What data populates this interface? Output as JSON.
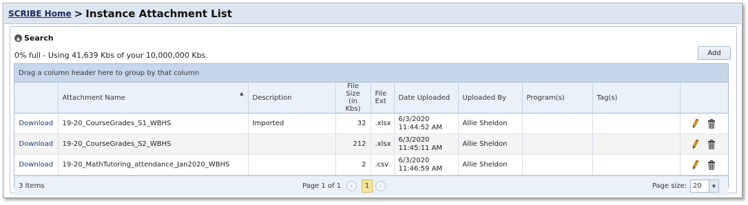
{
  "header": {
    "breadcrumb_home": "SCRIBE Home",
    "separator": ">",
    "title": "Instance Attachment List"
  },
  "search": {
    "label": "Search",
    "icon": "collapse-circle-icon"
  },
  "usage_text": "0% full - Using 41,639 Kbs of your 10,000,000 Kbs.",
  "add_label": "Add",
  "grid": {
    "group_hint": "Drag a column header here to group by that column",
    "columns": {
      "attachment_name": "Attachment Name",
      "description": "Description",
      "file_size_1": "File Size",
      "file_size_2": "(in Kbs)",
      "file_ext_1": "File",
      "file_ext_2": "Ext",
      "date_uploaded": "Date Uploaded",
      "uploaded_by": "Uploaded By",
      "programs": "Program(s)",
      "tags": "Tag(s)"
    },
    "rows": [
      {
        "action": "Download",
        "name": "19-20_CourseGrades_S1_WBHS",
        "description": "Imported",
        "size": "32",
        "ext": ".xlsx",
        "date": "6/3/2020",
        "time": "11:44:52 AM",
        "by": "Allie Sheldon",
        "programs": "",
        "tags": ""
      },
      {
        "action": "Download",
        "name": "19-20_CourseGrades_S2_WBHS",
        "description": "",
        "size": "212",
        "ext": ".xlsx",
        "date": "6/3/2020",
        "time": "11:45:11 AM",
        "by": "Allie Sheldon",
        "programs": "",
        "tags": ""
      },
      {
        "action": "Download",
        "name": "19-20_MathTutoring_attendance_Jan2020_WBHS",
        "description": "",
        "size": "2",
        "ext": ".csv",
        "date": "6/3/2020",
        "time": "11:46:59 AM",
        "by": "Allie Sheldon",
        "programs": "",
        "tags": ""
      }
    ]
  },
  "pager": {
    "items": "3 Items",
    "page_info": "Page 1 of 1",
    "current_page": "1",
    "page_size_label": "Page size:",
    "page_size": "20"
  },
  "colors": {
    "titlebar": "#dce6f2",
    "groupbar": "#c6d7ec",
    "current_page": "#f7e49a"
  }
}
